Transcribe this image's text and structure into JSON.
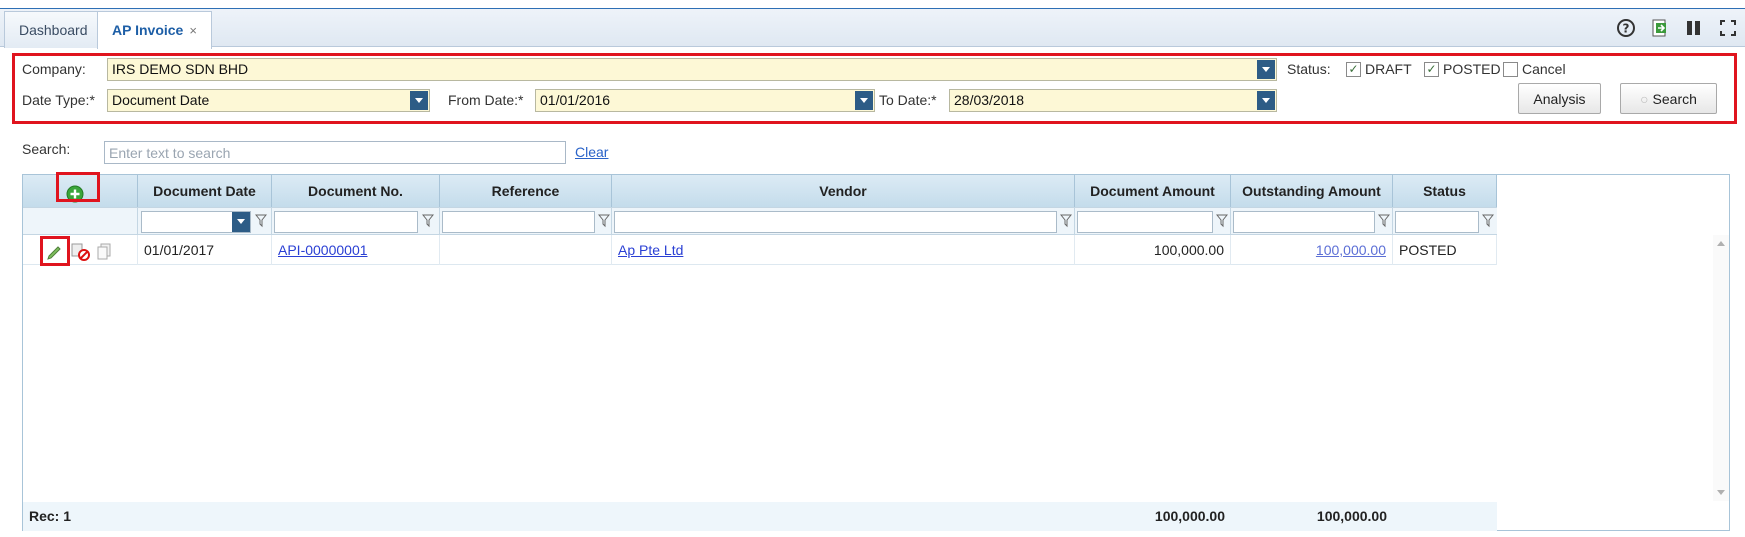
{
  "tabs": [
    {
      "label": "Dashboard",
      "active": false
    },
    {
      "label": "AP Invoice",
      "active": true,
      "close": "×"
    }
  ],
  "toolbar_icons": [
    "help-icon",
    "export-icon",
    "columns-icon",
    "fullscreen-icon"
  ],
  "filters": {
    "company_label": "Company:",
    "company_value": "IRS DEMO SDN BHD",
    "status_label": "Status:",
    "status_options": [
      {
        "label": "DRAFT",
        "checked": true
      },
      {
        "label": "POSTED",
        "checked": true
      },
      {
        "label": "Cancel",
        "checked": false
      }
    ],
    "date_type_label": "Date Type:*",
    "date_type_value": "Document Date",
    "from_date_label": "From Date:*",
    "from_date_value": "01/01/2016",
    "to_date_label": "To Date:*",
    "to_date_value": "28/03/2018",
    "analysis_label": "Analysis",
    "search_label": "Search"
  },
  "search": {
    "label": "Search:",
    "placeholder": "Enter text to search",
    "clear_label": "Clear"
  },
  "grid": {
    "columns": [
      "Document Date",
      "Document No.",
      "Reference",
      "Vendor",
      "Document Amount",
      "Outstanding Amount",
      "Status"
    ],
    "rows": [
      {
        "document_date": "01/01/2017",
        "document_no": "API-00000001",
        "reference": "",
        "vendor": "Ap Pte Ltd",
        "document_amount": "100,000.00",
        "outstanding_amount": "100,000.00",
        "status": "POSTED"
      }
    ],
    "footer": {
      "record_count": "Rec: 1",
      "document_amount_total": "100,000.00",
      "outstanding_amount_total": "100,000.00"
    }
  },
  "colors": {
    "highlight": "#e0141e",
    "header_bg": "#c4dceb",
    "input_bg": "#fdf8d6",
    "link": "#2a3fd4",
    "combo_arrow": "#2d5c86"
  }
}
